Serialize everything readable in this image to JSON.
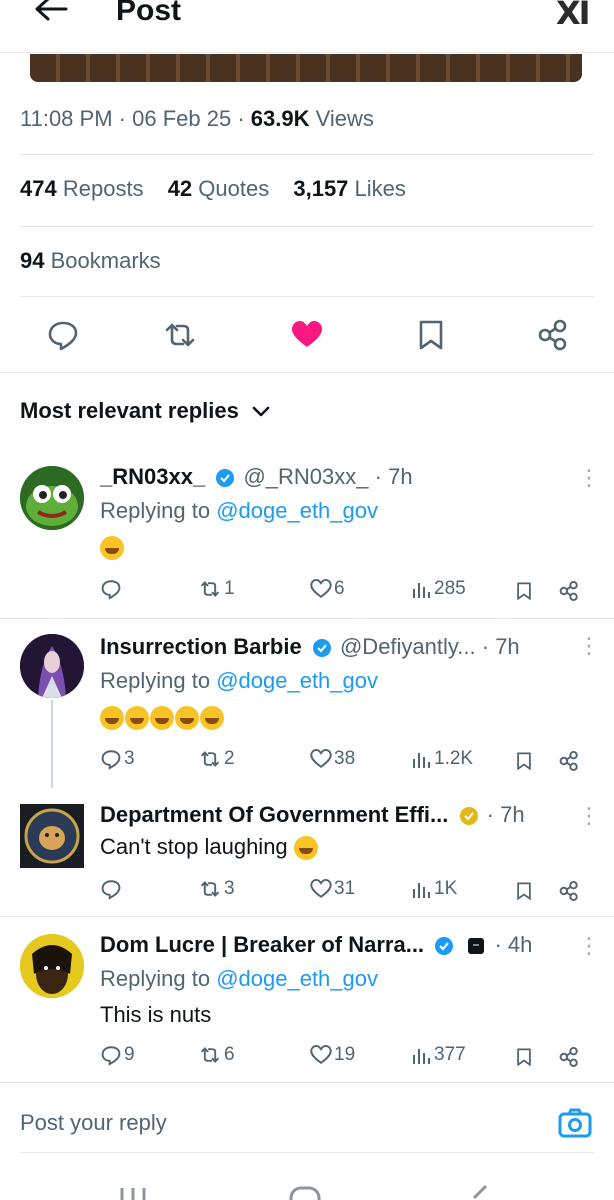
{
  "header": {
    "title": "Post",
    "logo_text": "XI"
  },
  "post_meta": {
    "time": "11:08 PM",
    "sep1": "·",
    "date": "06 Feb 25",
    "sep2": "·",
    "views_count": "63.9K",
    "views_label": "Views"
  },
  "stats": {
    "reposts_count": "474",
    "reposts_label": "Reposts",
    "quotes_count": "42",
    "quotes_label": "Quotes",
    "likes_count": "3,157",
    "likes_label": "Likes",
    "bookmarks_count": "94",
    "bookmarks_label": "Bookmarks"
  },
  "actions": [
    "reply-icon",
    "repost-icon",
    "like-icon-filled",
    "bookmark-icon",
    "share-icon"
  ],
  "colors": {
    "accent": "#1d9bf0",
    "like": "#f91880",
    "muted": "#536471",
    "verified_blue": "#1d9bf0",
    "verified_gold": "#e2b719"
  },
  "sort": {
    "label": "Most relevant replies"
  },
  "replies": [
    {
      "name": "_RN03xx_",
      "handle": "@_RN03xx_",
      "dot": "·",
      "time": "7h",
      "replying_prefix": "Replying to",
      "replying_handle": "@doge_eth_gov",
      "text": "",
      "emoji_count": 1,
      "replies": "",
      "reposts": "1",
      "likes": "6",
      "views": "285"
    },
    {
      "name": "Insurrection Barbie",
      "handle": "@Defiyantly...",
      "dot": "·",
      "time": "7h",
      "replying_prefix": "Replying to",
      "replying_handle": "@doge_eth_gov",
      "text": "",
      "emoji_count": 5,
      "replies": "3",
      "reposts": "2",
      "likes": "38",
      "views": "1.2K"
    },
    {
      "name": "Department Of Government Effi...",
      "handle": "",
      "dot": "·",
      "time": "7h",
      "text": "Can't stop laughing",
      "replies": "",
      "reposts": "3",
      "likes": "31",
      "views": "1K"
    },
    {
      "name": "Dom Lucre | Breaker of Narra...",
      "handle": "",
      "dot": "·",
      "time": "4h",
      "replying_prefix": "Replying to",
      "replying_handle": "@doge_eth_gov",
      "text": "This is nuts",
      "replies": "9",
      "reposts": "6",
      "likes": "19",
      "views": "377"
    }
  ],
  "compose": {
    "placeholder": "Post your reply"
  }
}
